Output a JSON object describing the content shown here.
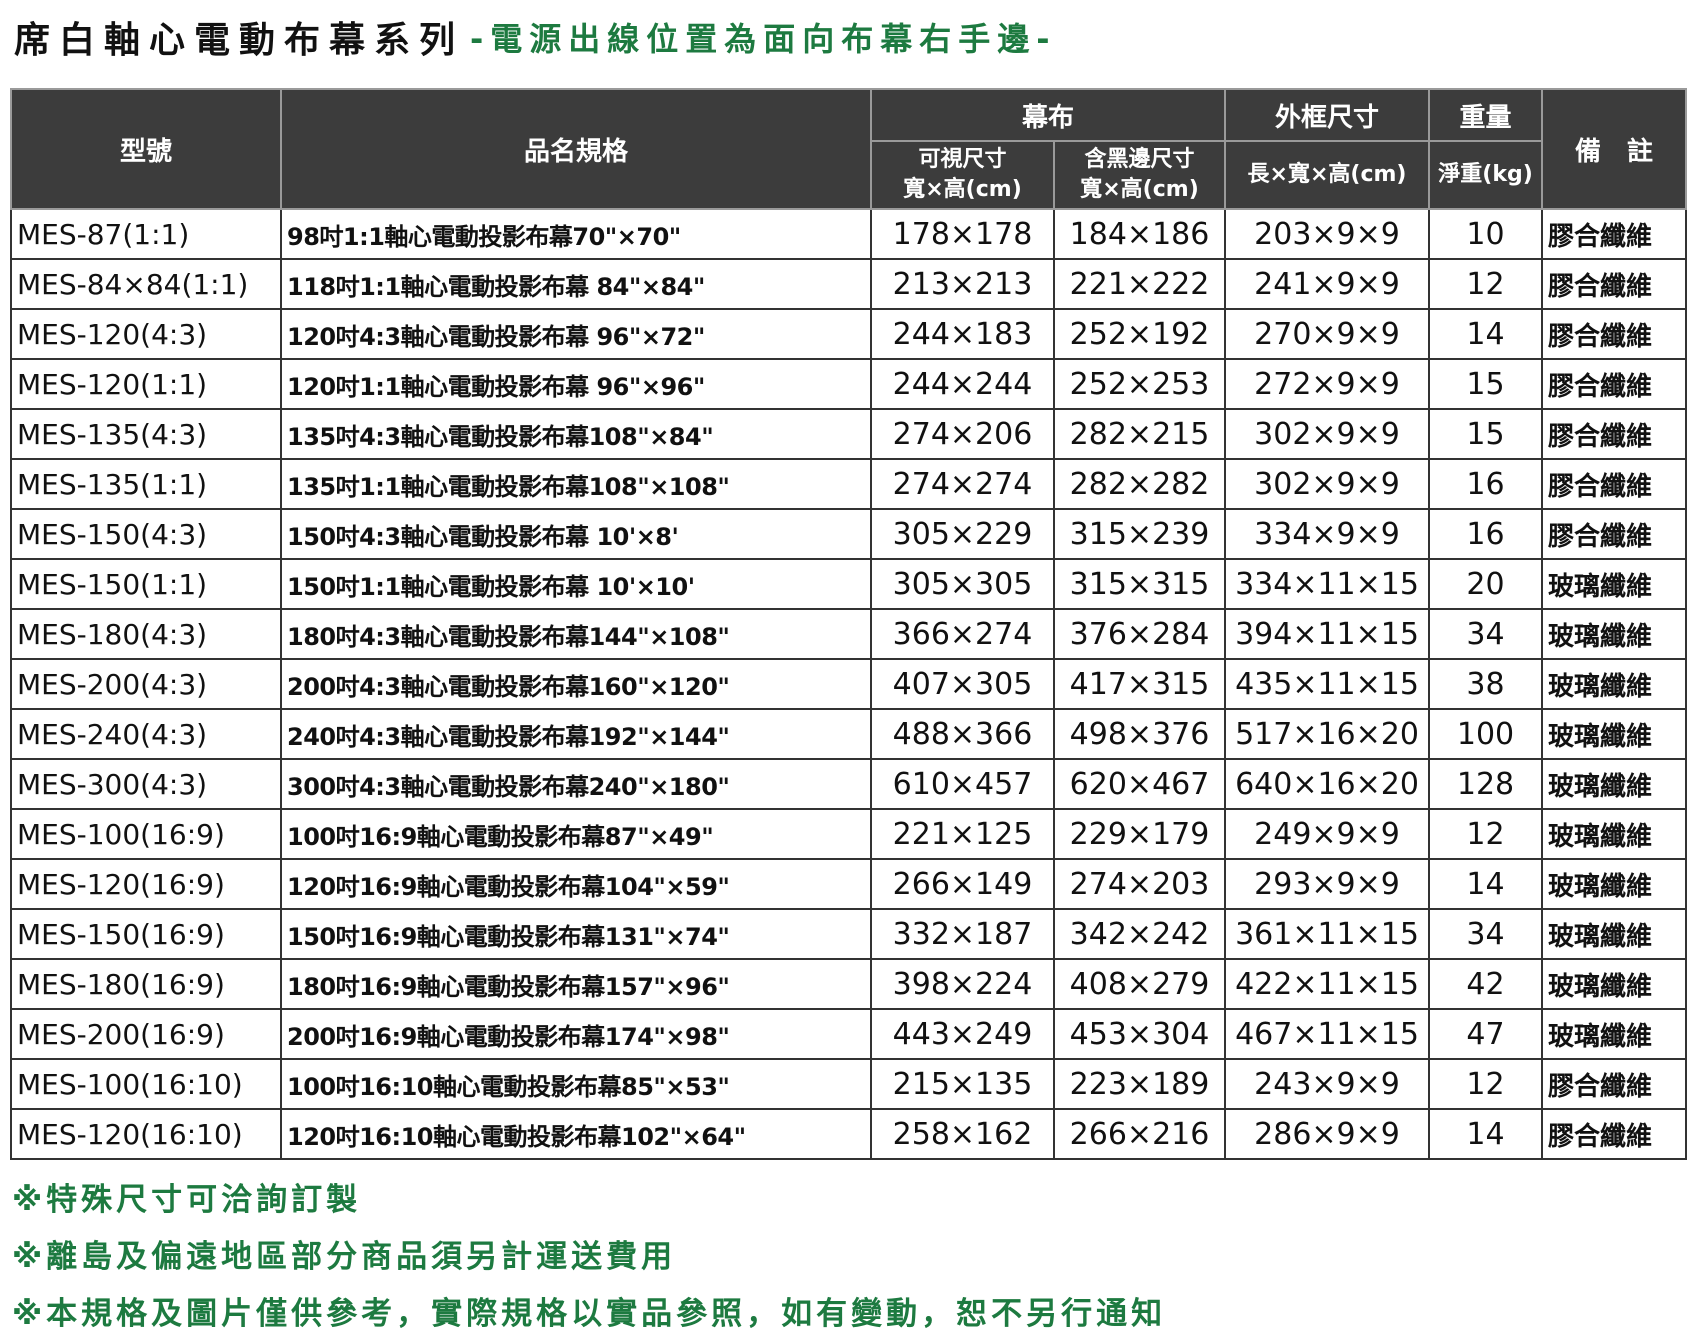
{
  "title": {
    "main": "席白軸心電動布幕系列",
    "sub": "-電源出線位置為面向布幕右手邊-"
  },
  "table": {
    "headers": {
      "model": "型號",
      "name": "品名規格",
      "screen": "幕布",
      "visible": "可視尺寸",
      "visible_unit": "寬×高(cm)",
      "border": "含黑邊尺寸",
      "border_unit": "寬×高(cm)",
      "frame": "外框尺寸",
      "frame_unit": "長×寬×高(cm)",
      "weight": "重量",
      "weight_unit": "淨重(kg)",
      "remark": "備　註"
    },
    "rows": [
      {
        "model": "MES-87(1:1)",
        "name": "98吋1:1軸心電動投影布幕70\"×70\"",
        "visible": "178×178",
        "border": "184×186",
        "frame": "203×9×9",
        "weight": "10",
        "remark": "膠合纖維"
      },
      {
        "model": "MES-84×84(1:1)",
        "name": "118吋1:1軸心電動投影布幕 84\"×84\"",
        "visible": "213×213",
        "border": "221×222",
        "frame": "241×9×9",
        "weight": "12",
        "remark": "膠合纖維"
      },
      {
        "model": "MES-120(4:3)",
        "name": "120吋4:3軸心電動投影布幕 96\"×72\"",
        "visible": "244×183",
        "border": "252×192",
        "frame": "270×9×9",
        "weight": "14",
        "remark": "膠合纖維"
      },
      {
        "model": "MES-120(1:1)",
        "name": "120吋1:1軸心電動投影布幕 96\"×96\"",
        "visible": "244×244",
        "border": "252×253",
        "frame": "272×9×9",
        "weight": "15",
        "remark": "膠合纖維"
      },
      {
        "model": "MES-135(4:3)",
        "name": "135吋4:3軸心電動投影布幕108\"×84\"",
        "visible": "274×206",
        "border": "282×215",
        "frame": "302×9×9",
        "weight": "15",
        "remark": "膠合纖維"
      },
      {
        "model": "MES-135(1:1)",
        "name": "135吋1:1軸心電動投影布幕108\"×108\"",
        "visible": "274×274",
        "border": "282×282",
        "frame": "302×9×9",
        "weight": "16",
        "remark": "膠合纖維"
      },
      {
        "model": "MES-150(4:3)",
        "name": "150吋4:3軸心電動投影布幕 10'×8'",
        "visible": "305×229",
        "border": "315×239",
        "frame": "334×9×9",
        "weight": "16",
        "remark": "膠合纖維"
      },
      {
        "model": "MES-150(1:1)",
        "name": "150吋1:1軸心電動投影布幕 10'×10'",
        "visible": "305×305",
        "border": "315×315",
        "frame": "334×11×15",
        "weight": "20",
        "remark": "玻璃纖維"
      },
      {
        "model": "MES-180(4:3)",
        "name": "180吋4:3軸心電動投影布幕144\"×108\"",
        "visible": "366×274",
        "border": "376×284",
        "frame": "394×11×15",
        "weight": "34",
        "remark": "玻璃纖維"
      },
      {
        "model": "MES-200(4:3)",
        "name": "200吋4:3軸心電動投影布幕160\"×120\"",
        "visible": "407×305",
        "border": "417×315",
        "frame": "435×11×15",
        "weight": "38",
        "remark": "玻璃纖維"
      },
      {
        "model": "MES-240(4:3)",
        "name": "240吋4:3軸心電動投影布幕192\"×144\"",
        "visible": "488×366",
        "border": "498×376",
        "frame": "517×16×20",
        "weight": "100",
        "remark": "玻璃纖維"
      },
      {
        "model": "MES-300(4:3)",
        "name": "300吋4:3軸心電動投影布幕240\"×180\"",
        "visible": "610×457",
        "border": "620×467",
        "frame": "640×16×20",
        "weight": "128",
        "remark": "玻璃纖維"
      },
      {
        "model": "MES-100(16:9)",
        "name": "100吋16:9軸心電動投影布幕87\"×49\"",
        "visible": "221×125",
        "border": "229×179",
        "frame": "249×9×9",
        "weight": "12",
        "remark": "玻璃纖維"
      },
      {
        "model": "MES-120(16:9)",
        "name": "120吋16:9軸心電動投影布幕104\"×59\"",
        "visible": "266×149",
        "border": "274×203",
        "frame": "293×9×9",
        "weight": "14",
        "remark": "玻璃纖維"
      },
      {
        "model": "MES-150(16:9)",
        "name": "150吋16:9軸心電動投影布幕131\"×74\"",
        "visible": "332×187",
        "border": "342×242",
        "frame": "361×11×15",
        "weight": "34",
        "remark": "玻璃纖維"
      },
      {
        "model": "MES-180(16:9)",
        "name": "180吋16:9軸心電動投影布幕157\"×96\"",
        "visible": "398×224",
        "border": "408×279",
        "frame": "422×11×15",
        "weight": "42",
        "remark": "玻璃纖維"
      },
      {
        "model": "MES-200(16:9)",
        "name": "200吋16:9軸心電動投影布幕174\"×98\"",
        "visible": "443×249",
        "border": "453×304",
        "frame": "467×11×15",
        "weight": "47",
        "remark": "玻璃纖維"
      },
      {
        "model": "MES-100(16:10)",
        "name": "100吋16:10軸心電動投影布幕85\"×53\"",
        "visible": "215×135",
        "border": "223×189",
        "frame": "243×9×9",
        "weight": "12",
        "remark": "膠合纖維"
      },
      {
        "model": "MES-120(16:10)",
        "name": "120吋16:10軸心電動投影布幕102\"×64\"",
        "visible": "258×162",
        "border": "266×216",
        "frame": "286×9×9",
        "weight": "14",
        "remark": "膠合纖維"
      }
    ]
  },
  "notes": [
    "※特殊尺寸可洽詢訂製",
    "※離島及偏遠地區部分商品須另計運送費用",
    "※本規格及圖片僅供參考，實際規格以實品參照，如有變動，恕不另行通知"
  ],
  "colors": {
    "header_bg": "#3c3c3c",
    "accent_green": "#1d7a40"
  }
}
